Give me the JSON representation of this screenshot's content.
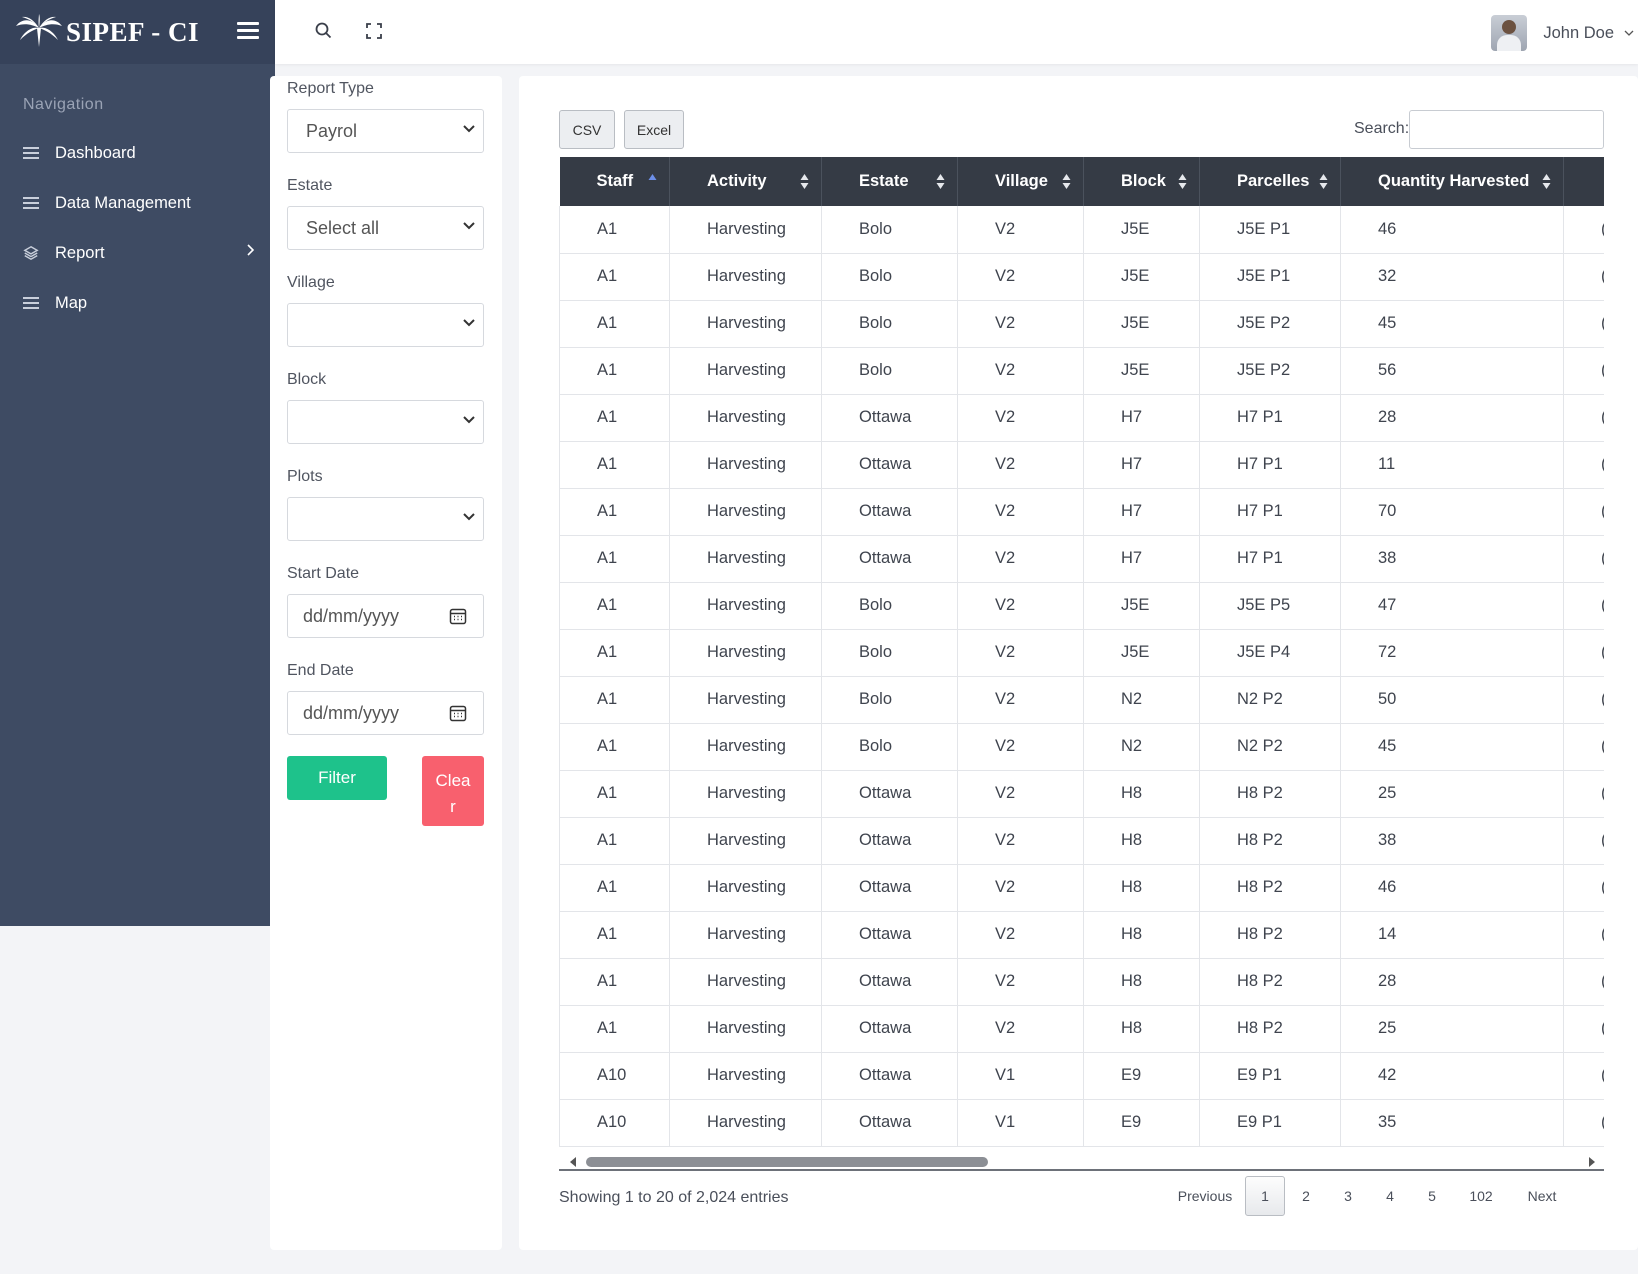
{
  "brand": {
    "name": "SIPEF - CI"
  },
  "sidebar": {
    "heading": "Navigation",
    "items": [
      {
        "label": "Dashboard",
        "icon": "menu-icon"
      },
      {
        "label": "Data Management",
        "icon": "menu-icon"
      },
      {
        "label": "Report",
        "icon": "layers-icon",
        "has_submenu": true
      },
      {
        "label": "Map",
        "icon": "menu-icon"
      }
    ]
  },
  "topbar": {
    "user_name": "John Doe"
  },
  "filters": {
    "report_type": {
      "label": "Report Type",
      "value": "Payrol"
    },
    "estate": {
      "label": "Estate",
      "value": "Select all"
    },
    "village": {
      "label": "Village",
      "value": ""
    },
    "block": {
      "label": "Block",
      "value": ""
    },
    "plots": {
      "label": "Plots",
      "value": ""
    },
    "start_date": {
      "label": "Start Date",
      "placeholder": "dd/mm/yyyy"
    },
    "end_date": {
      "label": "End Date",
      "placeholder": "dd/mm/yyyy"
    },
    "filter_button": "Filter",
    "clear_button": "Clear"
  },
  "table_tools": {
    "csv_button": "CSV",
    "excel_button": "Excel",
    "search_label": "Search:"
  },
  "table": {
    "columns": [
      "Staff",
      "Activity",
      "Estate",
      "Village",
      "Block",
      "Parcelles",
      "Quantity Harvested",
      ""
    ],
    "sorted_column": "Staff",
    "rows": [
      [
        "A1",
        "Harvesting",
        "Bolo",
        "V2",
        "J5E",
        "J5E P1",
        "46",
        "("
      ],
      [
        "A1",
        "Harvesting",
        "Bolo",
        "V2",
        "J5E",
        "J5E P1",
        "32",
        "("
      ],
      [
        "A1",
        "Harvesting",
        "Bolo",
        "V2",
        "J5E",
        "J5E P2",
        "45",
        "("
      ],
      [
        "A1",
        "Harvesting",
        "Bolo",
        "V2",
        "J5E",
        "J5E P2",
        "56",
        "("
      ],
      [
        "A1",
        "Harvesting",
        "Ottawa",
        "V2",
        "H7",
        "H7 P1",
        "28",
        "("
      ],
      [
        "A1",
        "Harvesting",
        "Ottawa",
        "V2",
        "H7",
        "H7 P1",
        "11",
        "("
      ],
      [
        "A1",
        "Harvesting",
        "Ottawa",
        "V2",
        "H7",
        "H7 P1",
        "70",
        "("
      ],
      [
        "A1",
        "Harvesting",
        "Ottawa",
        "V2",
        "H7",
        "H7 P1",
        "38",
        "("
      ],
      [
        "A1",
        "Harvesting",
        "Bolo",
        "V2",
        "J5E",
        "J5E P5",
        "47",
        "("
      ],
      [
        "A1",
        "Harvesting",
        "Bolo",
        "V2",
        "J5E",
        "J5E P4",
        "72",
        "("
      ],
      [
        "A1",
        "Harvesting",
        "Bolo",
        "V2",
        "N2",
        "N2 P2",
        "50",
        "("
      ],
      [
        "A1",
        "Harvesting",
        "Bolo",
        "V2",
        "N2",
        "N2 P2",
        "45",
        "("
      ],
      [
        "A1",
        "Harvesting",
        "Ottawa",
        "V2",
        "H8",
        "H8 P2",
        "25",
        "("
      ],
      [
        "A1",
        "Harvesting",
        "Ottawa",
        "V2",
        "H8",
        "H8 P2",
        "38",
        "("
      ],
      [
        "A1",
        "Harvesting",
        "Ottawa",
        "V2",
        "H8",
        "H8 P2",
        "46",
        "("
      ],
      [
        "A1",
        "Harvesting",
        "Ottawa",
        "V2",
        "H8",
        "H8 P2",
        "14",
        "("
      ],
      [
        "A1",
        "Harvesting",
        "Ottawa",
        "V2",
        "H8",
        "H8 P2",
        "28",
        "("
      ],
      [
        "A1",
        "Harvesting",
        "Ottawa",
        "V2",
        "H8",
        "H8 P2",
        "25",
        "("
      ],
      [
        "A10",
        "Harvesting",
        "Ottawa",
        "V1",
        "E9",
        "E9 P1",
        "42",
        "("
      ],
      [
        "A10",
        "Harvesting",
        "Ottawa",
        "V1",
        "E9",
        "E9 P1",
        "35",
        "("
      ]
    ]
  },
  "footer": {
    "info": "Showing 1 to 20 of 2,024 entries",
    "pagination": {
      "previous": "Previous",
      "pages": [
        "1",
        "2",
        "3",
        "4",
        "5",
        "102"
      ],
      "current": "1",
      "next": "Next"
    }
  },
  "colors": {
    "sidebar_bg": "#3e4b63",
    "table_header_bg": "#353b45",
    "filter_button": "#1ec28b",
    "clear_button": "#f8606e",
    "sort_active": "#6d8fe8"
  }
}
